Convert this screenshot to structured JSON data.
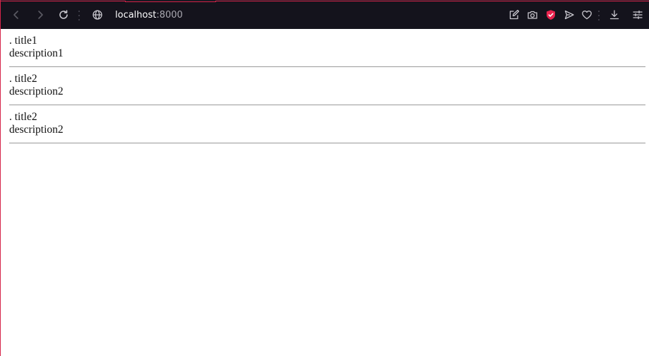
{
  "browser": {
    "address": {
      "host": "localhost",
      "port": ":8000"
    },
    "icons": {
      "back": "chevron-left-icon",
      "forward": "chevron-right-icon",
      "reload": "reload-icon",
      "site_info": "globe-icon",
      "edit": "edit-icon",
      "screenshot": "camera-icon",
      "shield": "shield-icon",
      "send": "send-icon",
      "favorite": "heart-icon",
      "download": "download-icon",
      "menu": "sliders-icon"
    },
    "colors": {
      "toolbar": "#14131c",
      "accent": "#d6244a",
      "host_text": "#ffffff",
      "port_text": "#a9a8b0"
    }
  },
  "page": {
    "items": [
      {
        "title": ". title1",
        "description": "description1"
      },
      {
        "title": ". title2",
        "description": "description2"
      },
      {
        "title": ". title2",
        "description": "description2"
      }
    ]
  }
}
